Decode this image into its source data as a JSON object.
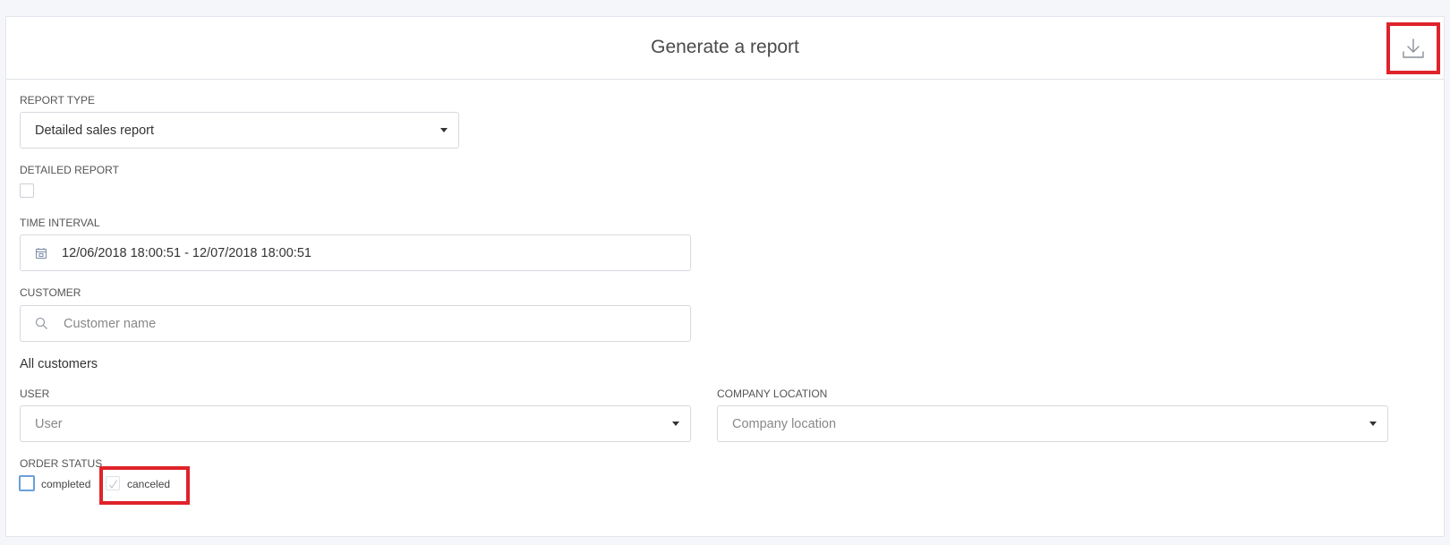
{
  "header": {
    "title": "Generate a report",
    "download_icon": "download-icon"
  },
  "report_type": {
    "label": "REPORT TYPE",
    "value": "Detailed sales report"
  },
  "detailed_report": {
    "label": "DETAILED REPORT",
    "checked": false
  },
  "time_interval": {
    "label": "TIME INTERVAL",
    "value": "12/06/2018 18:00:51 - 12/07/2018 18:00:51",
    "icon": "calendar-icon"
  },
  "customer": {
    "label": "CUSTOMER",
    "placeholder": "Customer name",
    "icon": "search-icon",
    "selection_text": "All customers"
  },
  "user": {
    "label": "USER",
    "placeholder": "User"
  },
  "company_location": {
    "label": "COMPANY LOCATION",
    "placeholder": "Company location"
  },
  "order_status": {
    "label": "ORDER STATUS",
    "options": [
      {
        "label": "completed",
        "checked": false
      },
      {
        "label": "canceled",
        "checked": true
      }
    ]
  },
  "colors": {
    "highlight": "#e0232b",
    "checkbox_focus": "#6b9fd8",
    "border": "#d6d9df",
    "page_background": "#f5f6fa"
  }
}
